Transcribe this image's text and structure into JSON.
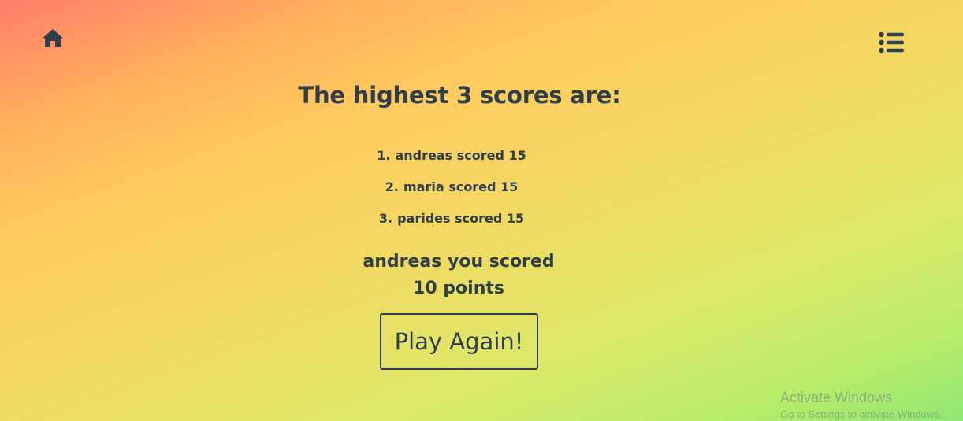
{
  "nav": {
    "home_icon": "home-icon",
    "menu_icon": "list-icon"
  },
  "main": {
    "title": "The highest 3 scores are:",
    "scores": [
      {
        "rank": "1.",
        "text": "andreas scored 15"
      },
      {
        "rank": "2.",
        "text": "maria scored 15"
      },
      {
        "rank": "3.",
        "text": "parides scored 15"
      }
    ],
    "result_line1": "andreas you scored",
    "result_line2": "10 points",
    "play_again_label": "Play Again!"
  },
  "watermark": {
    "title": "Activate Windows",
    "subtitle": "Go to Settings to activate Windows."
  },
  "colors": {
    "text": "#2f3e4b",
    "gradient_start": "#ff7e6b",
    "gradient_end": "#8fe875"
  }
}
